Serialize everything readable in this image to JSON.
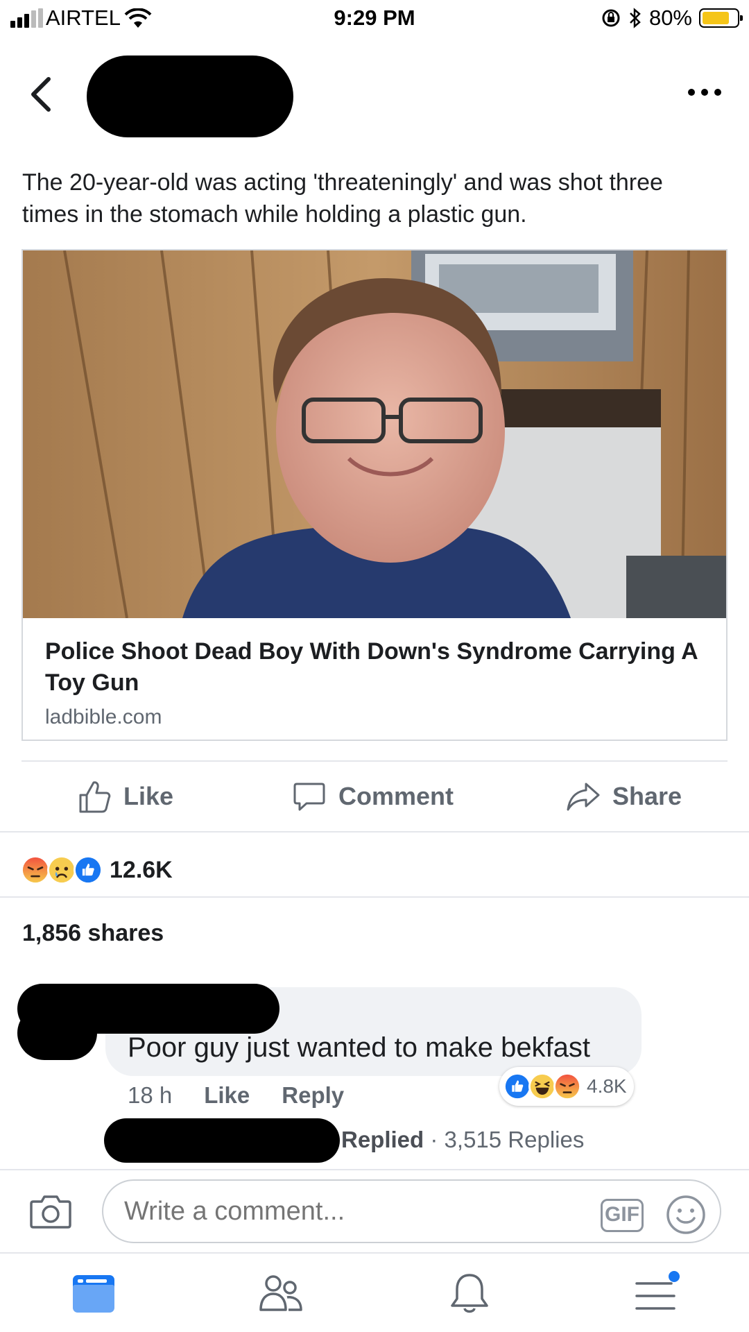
{
  "status_bar": {
    "carrier": "AIRTEL",
    "time": "9:29 PM",
    "battery": "80%"
  },
  "header": {
    "back_icon": "chevron-left-icon",
    "more_icon": "more-horizontal-icon"
  },
  "post": {
    "text": "The 20-year-old was acting 'threateningly' and was shot three times in the stomach while holding a plastic gun.",
    "link": {
      "title": "Police Shoot Dead Boy With Down's Syndrome Carrying A Toy Gun",
      "domain": "ladbible.com"
    }
  },
  "actions": {
    "like": "Like",
    "comment": "Comment",
    "share": "Share"
  },
  "reactions": {
    "icons": [
      "angry",
      "sad",
      "like"
    ],
    "count": "12.6K"
  },
  "shares": "1,856 shares",
  "comment": {
    "text": "Poor guy just wanted to make bekfast",
    "time": "18 h",
    "like": "Like",
    "reply": "Reply",
    "reaction_icons": [
      "like",
      "haha",
      "angry"
    ],
    "reaction_count": "4.8K",
    "replied_label": "Replied",
    "separator": "·",
    "replies": "3,515 Replies"
  },
  "composer": {
    "placeholder": "Write a comment...",
    "gif": "GIF"
  },
  "bottom_nav": [
    "news-feed-icon",
    "friends-icon",
    "bell-icon",
    "menu-icon"
  ],
  "colors": {
    "brand_blue": "#1877f2",
    "text": "#1c1e21",
    "secondary": "#606770",
    "redaction": "#000000"
  }
}
